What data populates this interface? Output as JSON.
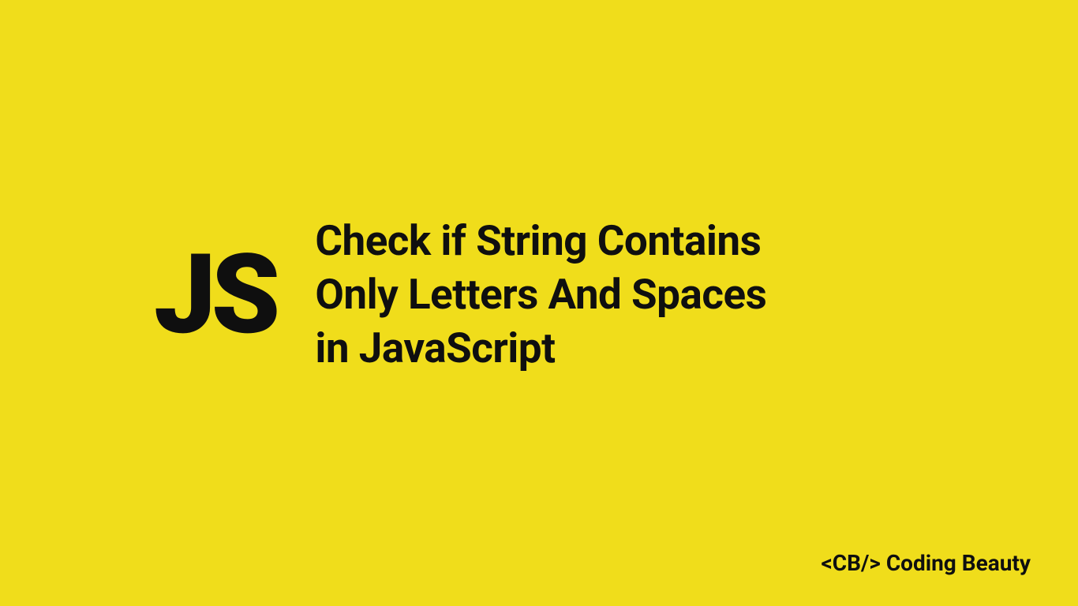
{
  "logo": {
    "text": "JS"
  },
  "title": {
    "line1": "Check if String Contains",
    "line2": "Only Letters And Spaces",
    "line3": "in JavaScript"
  },
  "footer": {
    "tag": "<CB/>",
    "brand": "Coding Beauty"
  },
  "colors": {
    "background": "#f0dd1b",
    "text": "#0f0f0f"
  }
}
